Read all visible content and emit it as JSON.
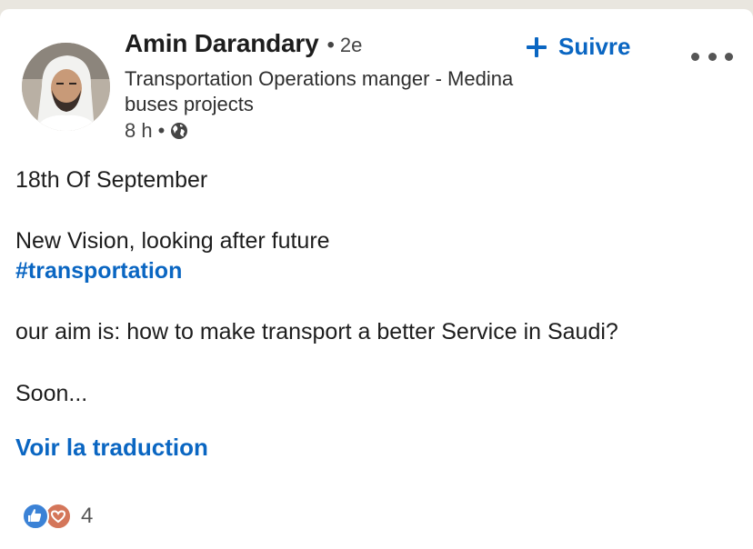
{
  "post": {
    "author": {
      "name": "Amin Darandary",
      "degree_separator": "•",
      "degree": "2e",
      "headline": "Transportation Operations manger - Medina buses projects",
      "time": "8 h",
      "meta_separator": "•",
      "visibility_icon": "globe-icon"
    },
    "follow_label": "Suivre",
    "follow_icon": "plus-icon",
    "more_icon": "more-options-icon",
    "body": {
      "line1": "18th Of September",
      "line2": "New Vision, looking after future",
      "hashtag": "#transportation",
      "line3": "our aim is: how to make transport a better Service in Saudi?",
      "line4": "Soon..."
    },
    "translate_label": "Voir la traduction",
    "reactions": {
      "icons": [
        "like-icon",
        "love-icon"
      ],
      "count": "4"
    }
  },
  "colors": {
    "link_blue": "#0a66c2",
    "text": "#1d1d1d",
    "secondary_text": "#444444",
    "background": "#e9e6df",
    "card": "#ffffff"
  }
}
